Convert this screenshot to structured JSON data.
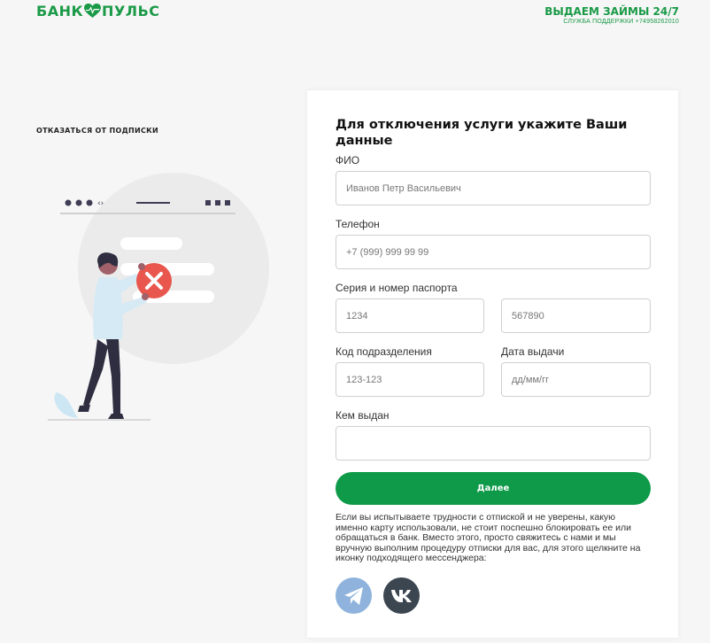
{
  "header": {
    "logo_left": "БАНК",
    "logo_right": "ПУЛЬС",
    "tagline": "ВЫДАЕМ ЗАЙМЫ 24/7",
    "support": "СЛУЖБА ПОДДЕРЖКИ +74958262010"
  },
  "sidebar": {
    "unsubscribe": "ОТКАЗАТЬСЯ ОТ ПОДПИСКИ"
  },
  "form": {
    "title": "Для отключения услуги укажите Ваши данные",
    "fio_label": "ФИО",
    "fio_placeholder": "Иванов Петр Васильевич",
    "phone_label": "Телефон",
    "phone_placeholder": "+7 (999) 999 99 99",
    "passport_label": "Серия и номер паспорта",
    "series_placeholder": "1234",
    "number_placeholder": "567890",
    "code_label": "Код подразделения",
    "code_placeholder": "123-123",
    "date_label": "Дата выдачи",
    "date_placeholder": "дд/мм/гг",
    "issued_label": "Кем выдан",
    "issued_placeholder": "",
    "submit": "Далее",
    "note": "Если вы испытываете трудности с отпиской и не уверены, какую именно карту использовали, не стоит поспешно блокировать ее или обращаться в банк. Вместо этого, просто свяжитесь с нами и мы вручную выполним процедуру отписки для вас, для этого щелкните на иконку подходящего мессенджера:"
  },
  "colors": {
    "brand": "#1a9a47",
    "button": "#0e9a48",
    "telegram": "#8fb3dc",
    "vk": "#3b4651",
    "error": "#e8564d"
  }
}
